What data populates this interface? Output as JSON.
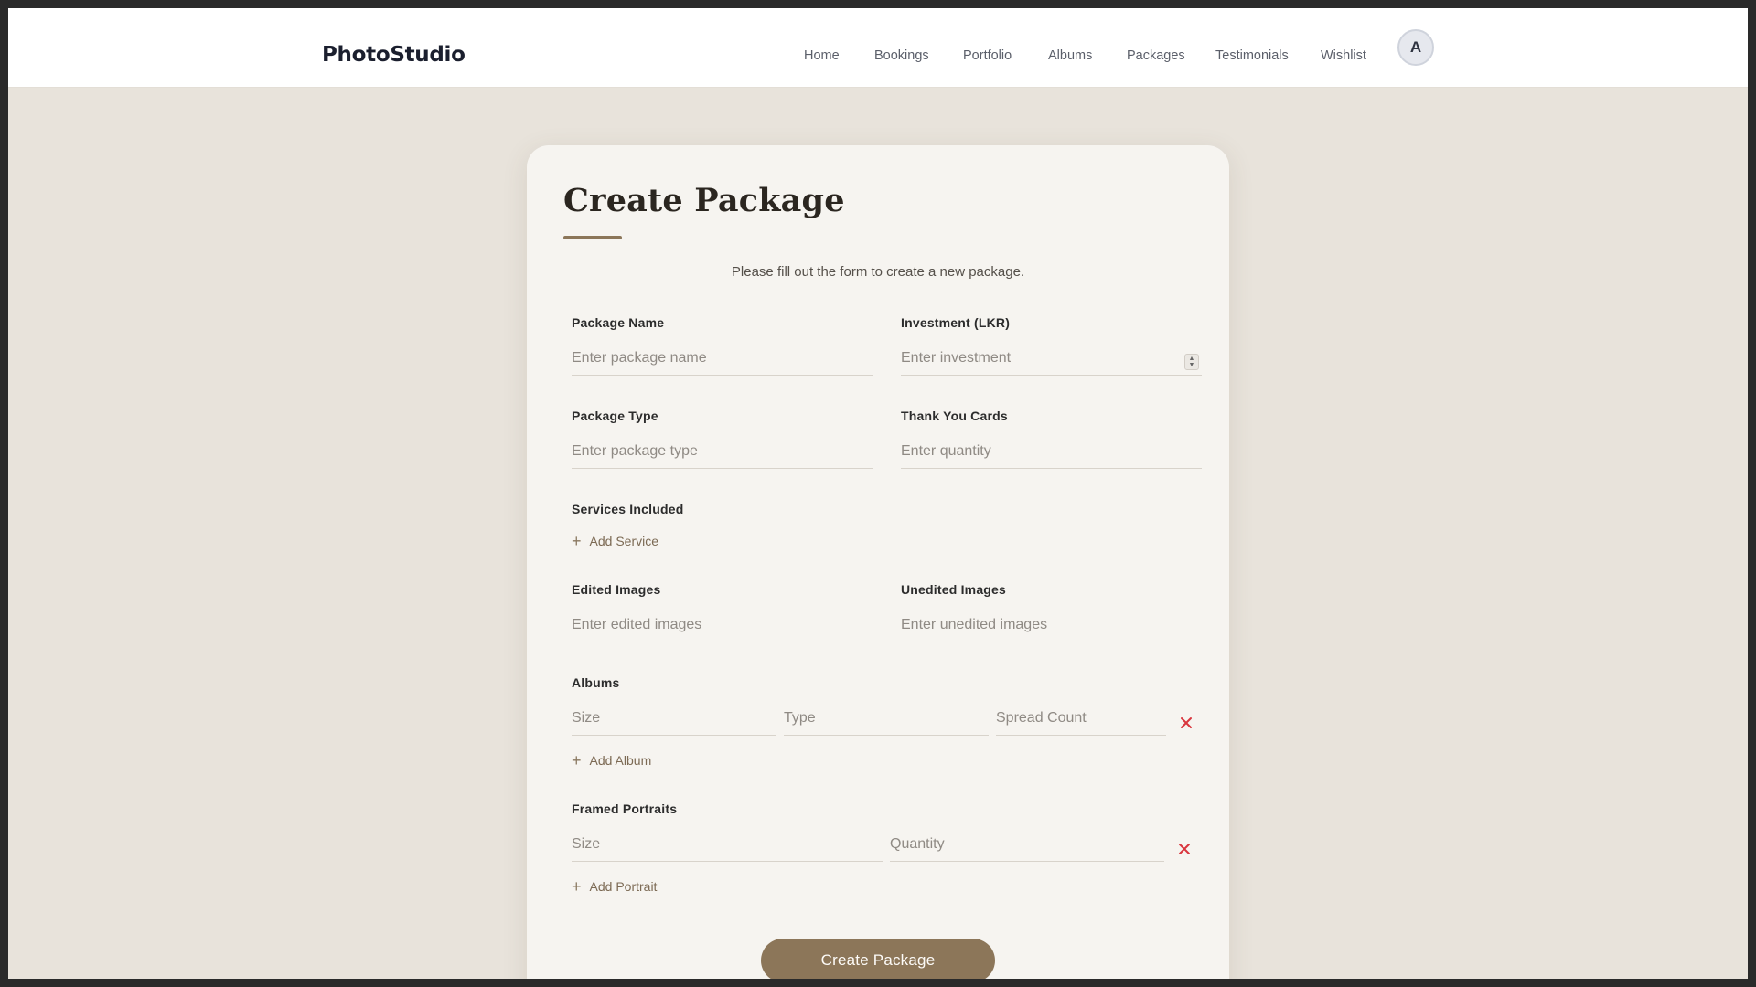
{
  "header": {
    "brand": "PhotoStudio",
    "nav": [
      "Home",
      "Bookings",
      "Portfolio",
      "Albums",
      "Packages",
      "Testimonials",
      "Wishlist"
    ],
    "avatar_initial": "A"
  },
  "form": {
    "title": "Create Package",
    "subtitle": "Please fill out the form to create a new package.",
    "package_name": {
      "label": "Package Name",
      "placeholder": "Enter package name"
    },
    "investment": {
      "label": "Investment (LKR)",
      "placeholder": "Enter investment"
    },
    "package_type": {
      "label": "Package Type",
      "placeholder": "Enter package type"
    },
    "thank_you_cards": {
      "label": "Thank You Cards",
      "placeholder": "Enter quantity"
    },
    "services": {
      "label": "Services Included",
      "add_label": "Add Service"
    },
    "edited_images": {
      "label": "Edited Images",
      "placeholder": "Enter edited images"
    },
    "unedited_images": {
      "label": "Unedited Images",
      "placeholder": "Enter unedited images"
    },
    "albums": {
      "label": "Albums",
      "size_placeholder": "Size",
      "type_placeholder": "Type",
      "spread_placeholder": "Spread Count",
      "add_label": "Add Album"
    },
    "portraits": {
      "label": "Framed Portraits",
      "size_placeholder": "Size",
      "quantity_placeholder": "Quantity",
      "add_label": "Add Portrait"
    },
    "submit_label": "Create Package"
  },
  "colors": {
    "accent": "#8c7659",
    "background": "#e8e3db",
    "card": "#f6f4f0",
    "remove": "#d9363e"
  }
}
